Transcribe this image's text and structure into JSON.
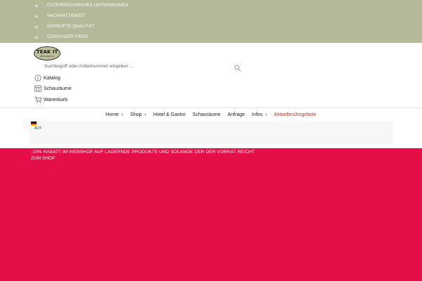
{
  "usps": [
    {
      "icon": "list-lines-icon",
      "label": "ÖSTERREICHISCHES UNTERNEHMEN"
    },
    {
      "icon": "list-lines-icon",
      "label": "NACHHALTIGKEIT"
    },
    {
      "icon": "list-lines-icon",
      "label": "GEPRÜFTE QUALITÄT"
    },
    {
      "icon": "list-lines-icon",
      "label": "GÜNSTIGER PREIS"
    }
  ],
  "logo": {
    "brand": "TEAK IT",
    "sub": "WWW.TEAKIT.AT"
  },
  "search": {
    "placeholder": "Suchbegriff oder Artikelnummer eingeben ..."
  },
  "header_links": [
    {
      "icon": "info-icon",
      "label": "Katalog"
    },
    {
      "icon": "showroom-icon",
      "label": "Schauräume"
    },
    {
      "icon": "cart-icon",
      "label": "Warenkorb"
    }
  ],
  "menu": [
    {
      "label": "Home",
      "chevron": "›"
    },
    {
      "label": "Shop",
      "chevron": "›"
    },
    {
      "label": "Hotel & Gastro",
      "chevron": ""
    },
    {
      "label": "Schauräume",
      "chevron": ""
    },
    {
      "label": "Anfrage",
      "chevron": ""
    },
    {
      "label": "Infos",
      "chevron": "›"
    },
    {
      "label": "Aktuelles/Angebote",
      "chevron": ""
    }
  ],
  "language": {
    "code": "AUT",
    "flag": "flag-icon"
  },
  "promo": {
    "text": "-10% RABATT IM WEBSHOP AUF LAGERNDE PRODUKTE UND SOLANGE DER DER VORRAT REICHT",
    "link": "ZUM SHOP"
  },
  "colors": {
    "topbar": "#b5b999",
    "promo": "#e50f47",
    "menu_active": "#c1392b"
  }
}
